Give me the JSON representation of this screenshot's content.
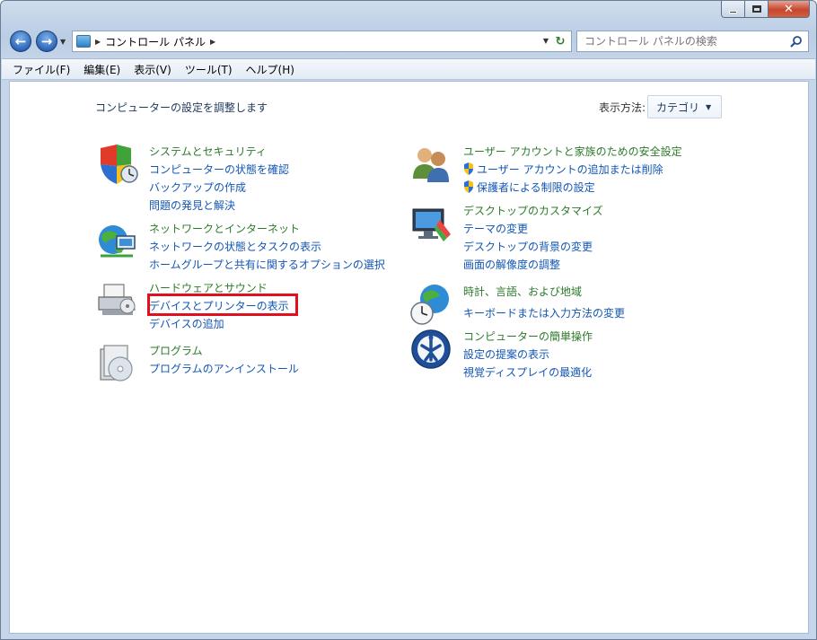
{
  "window": {
    "caption": {
      "minimize": "–",
      "maximize": "□",
      "close": "✕"
    }
  },
  "navigation": {
    "back_icon": "back-arrow-icon",
    "forward_icon": "forward-arrow-icon",
    "address": {
      "path_label": "コントロール パネル"
    },
    "search": {
      "placeholder": "コントロール パネルの検索"
    }
  },
  "menubar": {
    "items": [
      "ファイル(F)",
      "編集(E)",
      "表示(V)",
      "ツール(T)",
      "ヘルプ(H)"
    ]
  },
  "content": {
    "heading": "コンピューターの設定を調整します",
    "view_by_label": "表示方法:",
    "view_by_value": "カテゴリ",
    "categories": [
      {
        "title": "システムとセキュリティ",
        "icon": "shield-security-icon",
        "links": [
          "コンピューターの状態を確認",
          "バックアップの作成",
          "問題の発見と解決"
        ]
      },
      {
        "title": "ネットワークとインターネット",
        "icon": "network-globe-icon",
        "links": [
          "ネットワークの状態とタスクの表示",
          "ホームグループと共有に関するオプションの選択"
        ]
      },
      {
        "title": "ハードウェアとサウンド",
        "icon": "printer-hardware-icon",
        "links": [
          "デバイスとプリンターの表示",
          "デバイスの追加"
        ]
      },
      {
        "title": "プログラム",
        "icon": "programs-disc-icon",
        "links": [
          "プログラムのアンインストール"
        ]
      },
      {
        "title": "ユーザー アカウントと家族のための安全設定",
        "icon": "user-accounts-icon",
        "links": [
          "ユーザー アカウントの追加または削除",
          "保護者による制限の設定"
        ]
      },
      {
        "title": "デスクトップのカスタマイズ",
        "icon": "display-personalization-icon",
        "links": [
          "テーマの変更",
          "デスクトップの背景の変更",
          "画面の解像度の調整"
        ]
      },
      {
        "title": "時計、言語、および地域",
        "icon": "clock-globe-icon",
        "links": [
          "キーボードまたは入力方法の変更"
        ]
      },
      {
        "title": "コンピューターの簡単操作",
        "icon": "ease-of-access-icon",
        "links": [
          "設定の提案の表示",
          "視覚ディスプレイの最適化"
        ]
      }
    ]
  },
  "colors": {
    "category_title": "#2c7a2c",
    "link": "#1256b4",
    "highlight": "#e0101e"
  }
}
